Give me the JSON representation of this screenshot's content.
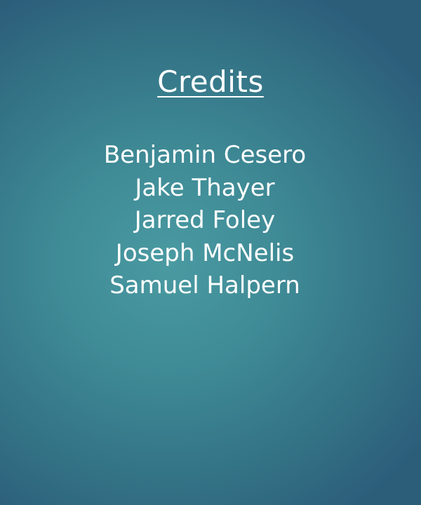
{
  "slide": {
    "title": "Credits",
    "names": [
      "Benjamin Cesero",
      "Jake Thayer",
      "Jarred Foley",
      "Joseph McNelis",
      "Samuel Halpern"
    ]
  }
}
